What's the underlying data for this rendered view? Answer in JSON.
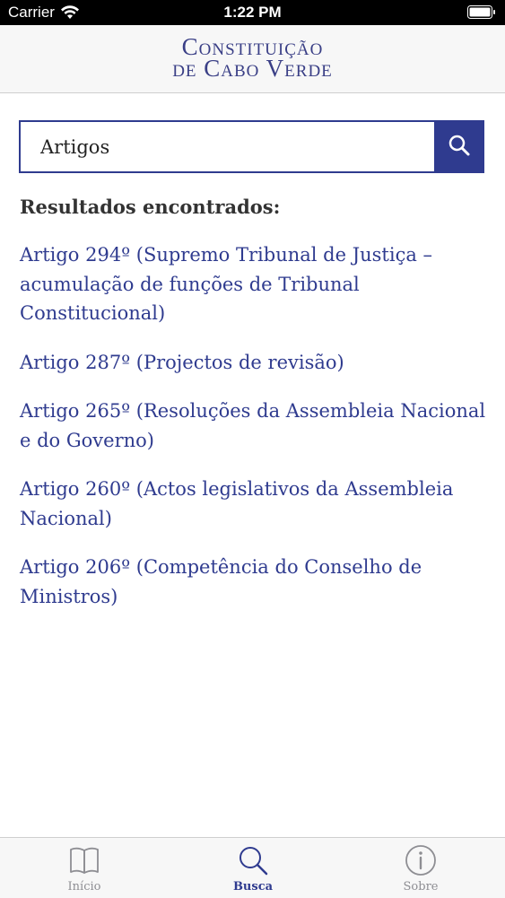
{
  "status_bar": {
    "carrier": "Carrier",
    "time": "1:22 PM"
  },
  "header": {
    "title_line1": "Constituição",
    "title_line2": "de Cabo Verde"
  },
  "search": {
    "value": "Artigos",
    "icon": "search-icon"
  },
  "results_heading": "Resultados encontrados:",
  "results": [
    "Artigo 294º (Supremo Tribunal de Justiça – acumulação de funções de Tribunal Constitucional)",
    "Artigo 287º (Projectos de revisão)",
    "Artigo 265º (Resoluções da Assembleia Nacional e do Governo)",
    "Artigo 260º (Actos legislativos da Assembleia Nacional)",
    "Artigo 206º (Competência do Conselho de Ministros)"
  ],
  "tabbar": {
    "tabs": [
      {
        "label": "Início",
        "icon": "book-icon"
      },
      {
        "label": "Busca",
        "icon": "search-icon"
      },
      {
        "label": "Sobre",
        "icon": "info-icon"
      }
    ],
    "active_index": 1
  },
  "colors": {
    "accent": "#2f3b8f",
    "inactive": "#8e8e93"
  }
}
